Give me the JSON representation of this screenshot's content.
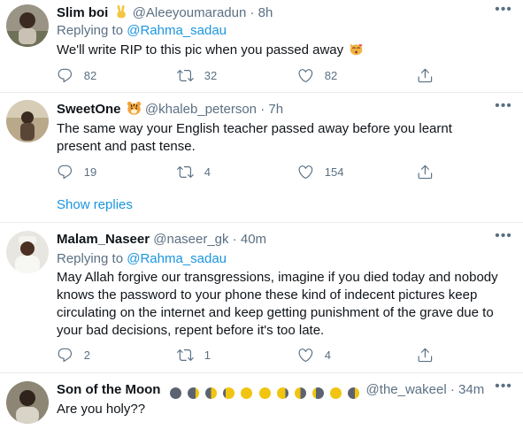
{
  "tweets": [
    {
      "name": "Slim boi",
      "handle": "@Aleeyoumaradun",
      "dot": "·",
      "time": "8h",
      "replying_prefix": "Replying to ",
      "replying_to": "@Rahma_sadau",
      "text": "We'll write RIP to this pic when you passed away",
      "replies": "82",
      "retweets": "32",
      "likes": "82"
    },
    {
      "name": "SweetOne",
      "handle": "@khaleb_peterson",
      "dot": "·",
      "time": "7h",
      "text": "The same way your English teacher passed away before you learnt present and past tense.",
      "replies": "19",
      "retweets": "4",
      "likes": "154"
    },
    {
      "name": "Malam_Naseer",
      "handle": "@naseer_gk",
      "dot": "·",
      "time": "40m",
      "replying_prefix": "Replying to ",
      "replying_to": "@Rahma_sadau",
      "text": "May Allah forgive our transgressions, imagine if you died today and nobody knows the password to your phone these kind of indecent pictures keep circulating on the internet and keep getting punishment of the grave due to your bad decisions, repent before it's too late.",
      "replies": "2",
      "retweets": "1",
      "likes": "4"
    },
    {
      "name": "Son of the Moon",
      "handle": "@the_wakeel",
      "dot": "·",
      "time": "34m",
      "text": "Are you holy??"
    }
  ],
  "show_replies": "Show replies",
  "colors": {
    "link": "#1b95e0",
    "secondary_text": "#5b7083",
    "divider": "#e6ecf0"
  },
  "icons": [
    "more-icon",
    "reply-icon",
    "retweet-icon",
    "like-icon",
    "share-icon",
    "victory-hand-emoji",
    "tiger-emoji",
    "kissing-cat-emoji",
    "moon-phase-emoji"
  ]
}
